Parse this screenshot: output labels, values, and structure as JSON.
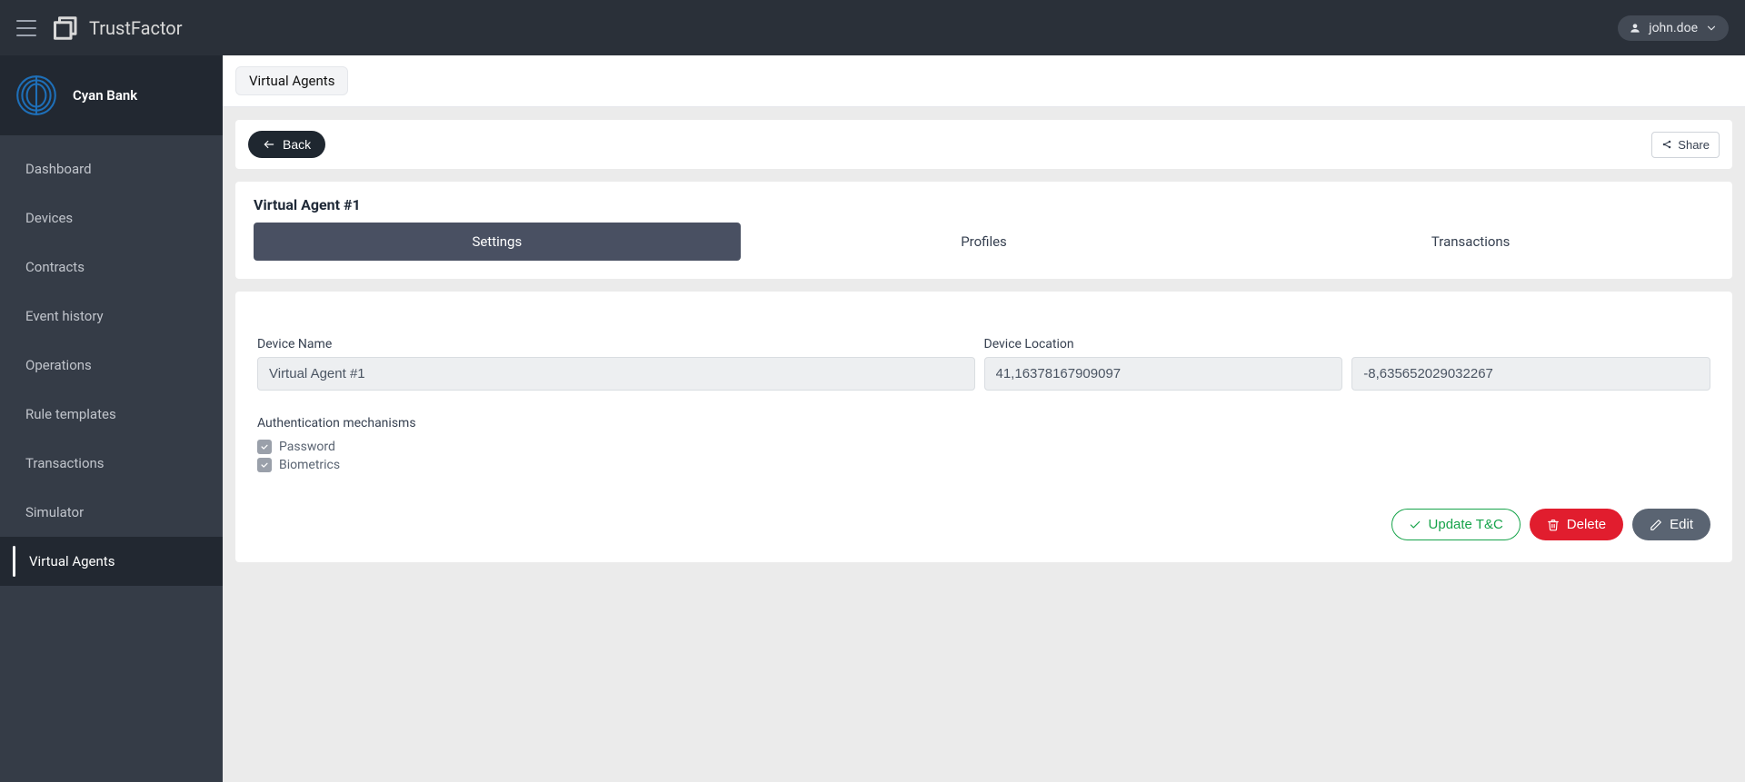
{
  "header": {
    "brand": "TrustFactor",
    "user": "john.doe"
  },
  "sidebar": {
    "orgName": "Cyan Bank",
    "items": [
      {
        "label": "Dashboard",
        "key": "dashboard",
        "active": false
      },
      {
        "label": "Devices",
        "key": "devices",
        "active": false
      },
      {
        "label": "Contracts",
        "key": "contracts",
        "active": false
      },
      {
        "label": "Event history",
        "key": "event-history",
        "active": false
      },
      {
        "label": "Operations",
        "key": "operations",
        "active": false
      },
      {
        "label": "Rule templates",
        "key": "rule-templates",
        "active": false
      },
      {
        "label": "Transactions",
        "key": "transactions",
        "active": false
      },
      {
        "label": "Simulator",
        "key": "simulator",
        "active": false
      },
      {
        "label": "Virtual Agents",
        "key": "virtual-agents",
        "active": true
      }
    ]
  },
  "breadcrumb": {
    "current": "Virtual Agents"
  },
  "toolbar": {
    "backLabel": "Back",
    "shareLabel": "Share"
  },
  "page": {
    "title": "Virtual Agent #1",
    "tabs": [
      {
        "label": "Settings",
        "key": "settings",
        "active": true
      },
      {
        "label": "Profiles",
        "key": "profiles",
        "active": false
      },
      {
        "label": "Transactions",
        "key": "transactions",
        "active": false
      }
    ]
  },
  "form": {
    "deviceNameLabel": "Device Name",
    "deviceName": "Virtual Agent #1",
    "deviceLocationLabel": "Device Location",
    "deviceLocationLat": "41,16378167909097",
    "deviceLocationLon": "-8,635652029032267",
    "authLabel": "Authentication mechanisms",
    "authOptions": [
      {
        "label": "Password",
        "checked": true
      },
      {
        "label": "Biometrics",
        "checked": true
      }
    ]
  },
  "actions": {
    "updateTc": "Update T&C",
    "delete": "Delete",
    "edit": "Edit"
  }
}
